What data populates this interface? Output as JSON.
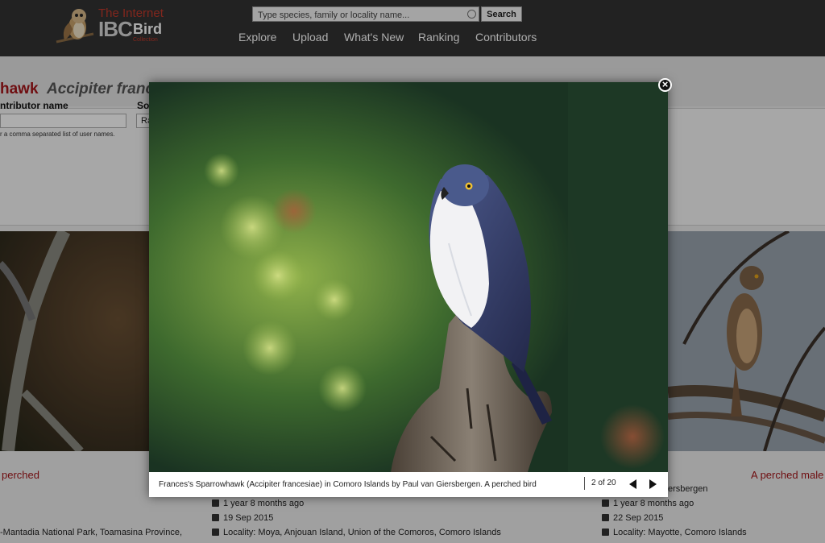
{
  "header": {
    "logo": {
      "line1": "The Internet",
      "ibc": "IBC",
      "bird": "Bird",
      "collection": "Collection"
    },
    "search": {
      "placeholder": "Type species, family or locality name...",
      "button_label": "Search"
    },
    "nav": [
      "Explore",
      "Upload",
      "What's New",
      "Ranking",
      "Contributors"
    ]
  },
  "species": {
    "common_fragment": "hawk",
    "scientific_fragment": "Accipiter france"
  },
  "filters": {
    "contributor_label": "ntributor name",
    "contributor_hint": "r a comma separated list of user names.",
    "sort_label": "So",
    "sort_value": "Ra"
  },
  "cards": {
    "left": {
      "caption": "perched",
      "locality": "-Mantadia National Park, Toamasina Province,"
    },
    "middle": {
      "age": "1 year 8 months ago",
      "date": "19 Sep 2015",
      "locality": "Locality: Moya, Anjouan Island, Union of the Comoros, Comoro Islands"
    },
    "right": {
      "caption": "A perched male",
      "author_fragment": "ersbergen",
      "age": "1 year 8 months ago",
      "date": "22 Sep 2015",
      "locality": "Locality: Mayotte, Comoro Islands"
    }
  },
  "lightbox": {
    "caption": "Frances's Sparrowhawk (Accipiter francesiae) in Comoro Islands by Paul van Giersbergen. A perched bird",
    "counter": "2 of 20",
    "close_icon": "close-icon",
    "prev_icon": "triangle-left-icon",
    "next_icon": "triangle-right-icon"
  },
  "colors": {
    "header_bg": "#333333",
    "accent_red": "#a4161a",
    "page_bg": "#ececec"
  }
}
